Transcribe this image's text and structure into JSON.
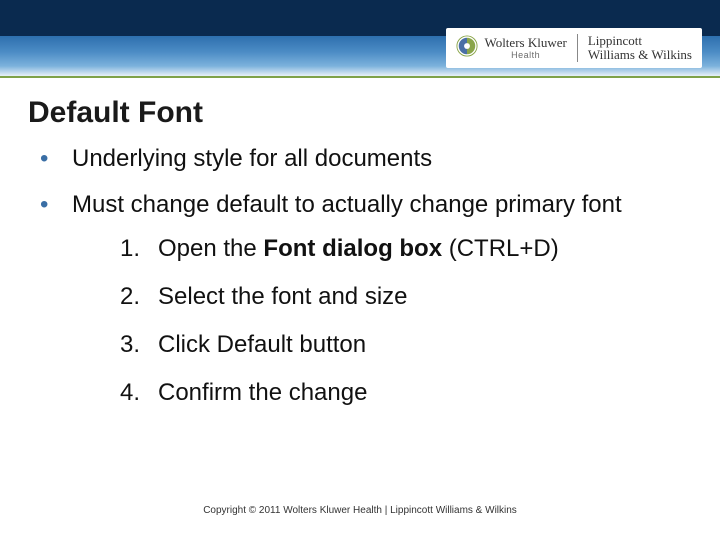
{
  "brand": {
    "wk_name": "Wolters Kluwer",
    "wk_health": "Health",
    "lww_line1": "Lippincott",
    "lww_line2": "Williams & Wilkins"
  },
  "title": "Default Font",
  "bullets": [
    "Underlying style for all documents",
    "Must change default to actually change primary font"
  ],
  "steps": [
    {
      "num": "1.",
      "pre": "Open the ",
      "bold": "Font dialog box",
      "post": " (CTRL+D)"
    },
    {
      "num": "2.",
      "pre": "Select the font and size",
      "bold": "",
      "post": ""
    },
    {
      "num": "3.",
      "pre": "Click Default button",
      "bold": "",
      "post": ""
    },
    {
      "num": "4.",
      "pre": "Confirm the change",
      "bold": "",
      "post": ""
    }
  ],
  "footer": "Copyright © 2011 Wolters Kluwer Health | Lippincott Williams & Wilkins"
}
